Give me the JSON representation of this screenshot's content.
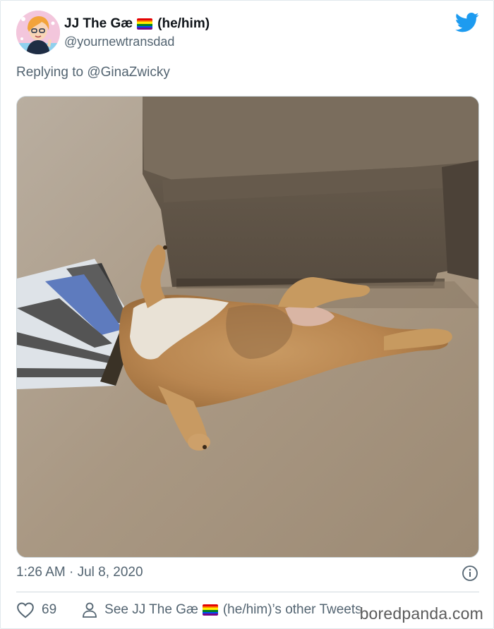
{
  "tweet": {
    "display_name": "JJ The Gæ",
    "display_name_suffix": "(he/him)",
    "handle": "@yournewtransdad",
    "replying_prefix": "Replying to",
    "replying_handle": "@GinaZwicky",
    "timestamp": "1:26 AM · Jul 8, 2020",
    "like_count": "69",
    "other_tweets_prefix": "See JJ The Gæ",
    "other_tweets_suffix": "(he/him)’s other Tweets"
  },
  "watermark": "boredpanda.com",
  "icons": {
    "brand": "twitter-bird-icon",
    "info": "info-icon",
    "like": "heart-icon",
    "profile": "person-icon",
    "flag": "rainbow-flag-emoji"
  },
  "colors": {
    "twitter_blue": "#1d9bf0",
    "muted_text": "#536471",
    "flag": [
      "#e40303",
      "#ff8c00",
      "#ffed00",
      "#008026",
      "#004dff",
      "#750787"
    ]
  }
}
